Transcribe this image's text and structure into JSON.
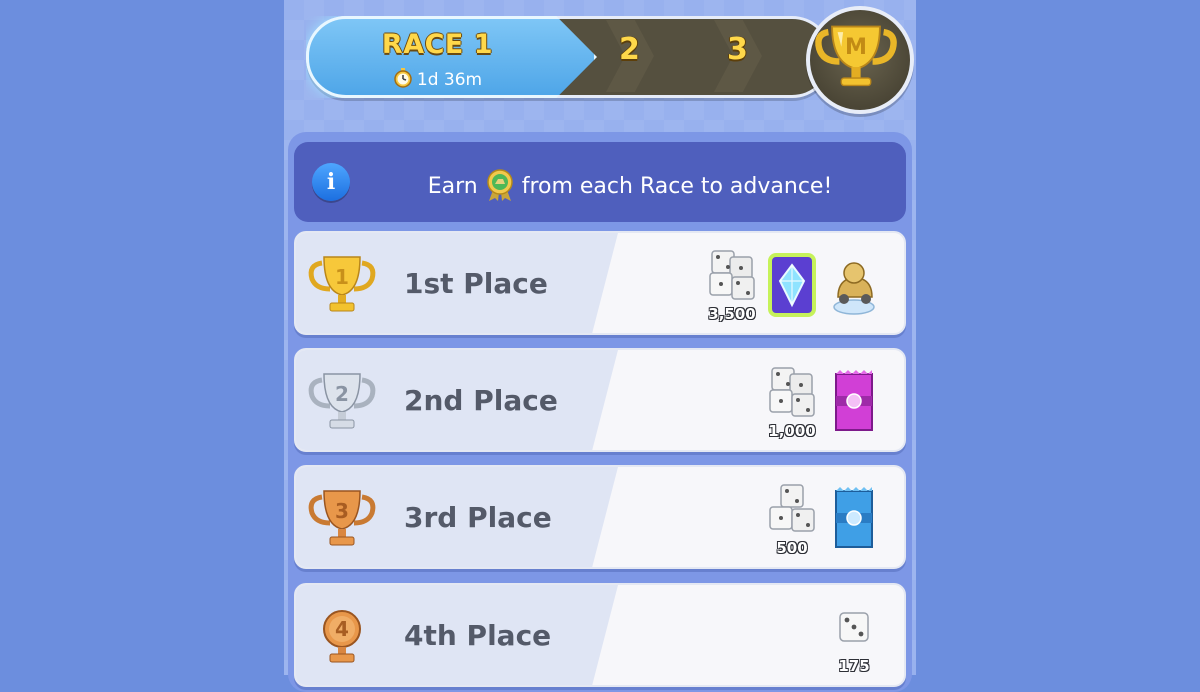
{
  "race_bar": {
    "current_race": "RACE 1",
    "timer": "1d 36m",
    "stages": [
      "2",
      "3"
    ],
    "icons": {
      "timer": "stopwatch-icon",
      "final": "gold-trophy-icon"
    }
  },
  "info_banner": {
    "text_before": "Earn",
    "text_after": "from each Race to advance!",
    "icons": {
      "info": "info-icon",
      "token": "ribbon-medal-icon"
    }
  },
  "rewards": [
    {
      "place": "1st Place",
      "trophy": "gold",
      "items": [
        {
          "type": "dice",
          "count": "3,500"
        },
        {
          "type": "wild-sticker-card",
          "count": ""
        },
        {
          "type": "race-car-token",
          "count": ""
        }
      ]
    },
    {
      "place": "2nd Place",
      "trophy": "silver",
      "items": [
        {
          "type": "dice",
          "count": "1,000"
        },
        {
          "type": "purple-sticker-pack",
          "count": ""
        }
      ]
    },
    {
      "place": "3rd Place",
      "trophy": "bronze",
      "items": [
        {
          "type": "dice",
          "count": "500"
        },
        {
          "type": "blue-sticker-pack",
          "count": ""
        }
      ]
    },
    {
      "place": "4th Place",
      "trophy": "bronze-medal",
      "items": [
        {
          "type": "single-die",
          "count": "175"
        }
      ]
    }
  ],
  "colors": {
    "background": "#6c8ede",
    "banner": "#4f5fbd",
    "active_race": "#5db3ef",
    "race_title": "#ffd84a",
    "track": "#55503f"
  }
}
